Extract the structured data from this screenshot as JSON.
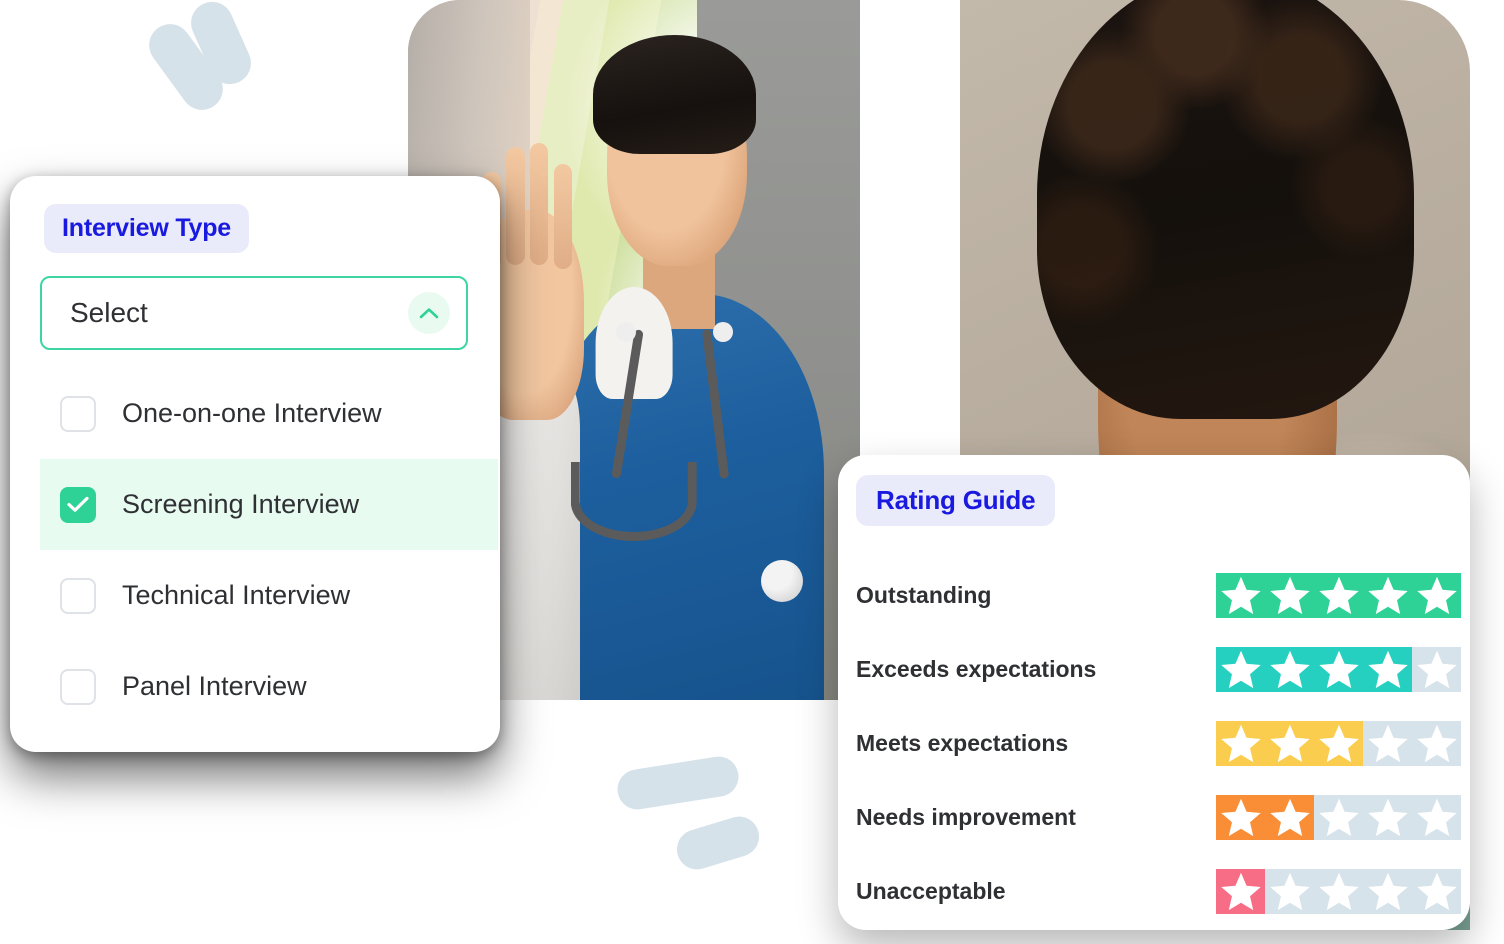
{
  "interview_card": {
    "badge": "Interview Type",
    "select": {
      "value": "Select",
      "placeholder": "Select",
      "chevron_icon": "chevron-up-icon",
      "border_color": "#3ed6a0"
    },
    "options": [
      {
        "label": "One-on-one Interview",
        "checked": false
      },
      {
        "label": "Screening Interview",
        "checked": true
      },
      {
        "label": "Technical Interview",
        "checked": false
      },
      {
        "label": "Panel Interview",
        "checked": false
      }
    ],
    "colors": {
      "badge_bg": "#e9ebfb",
      "badge_text": "#1a19df",
      "selected_row_bg": "#e8fbf1",
      "checkbox_checked": "#2ed196"
    }
  },
  "rating_card": {
    "badge": "Rating Guide",
    "total_stars": 5,
    "rows": [
      {
        "label": "Outstanding",
        "filled": 5,
        "color": "#2ed196"
      },
      {
        "label": "Exceeds expectations",
        "filled": 4,
        "color": "#26d0c0"
      },
      {
        "label": "Meets expectations",
        "filled": 3,
        "color": "#fbcd4e"
      },
      {
        "label": "Needs improvement",
        "filled": 2,
        "color": "#f98e36"
      },
      {
        "label": "Unacceptable",
        "filled": 1,
        "color": "#f76d85"
      }
    ],
    "colors": {
      "badge_bg": "#e9ebfb",
      "badge_text": "#1a19df",
      "empty_track": "#d7e3ea",
      "star_glyph": "#ffffff"
    }
  },
  "decorations": {
    "blob_color": "#d6e2e9",
    "blobs": [
      {
        "name": "blob-top-left-lower"
      },
      {
        "name": "blob-top-left-upper"
      },
      {
        "name": "blob-bottom-upper"
      },
      {
        "name": "blob-bottom-lower"
      }
    ]
  },
  "photos": [
    {
      "name": "photo-clinician-waving"
    },
    {
      "name": "photo-portrait-curly-hair"
    }
  ]
}
